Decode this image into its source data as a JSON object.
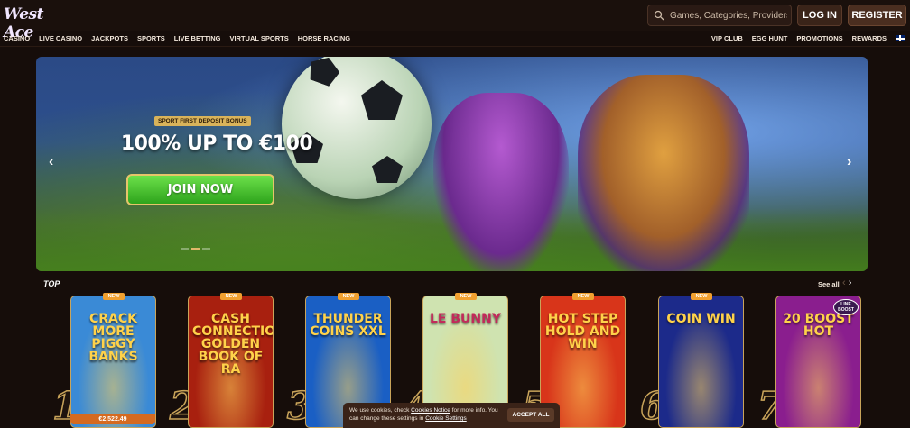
{
  "header": {
    "logo": "West Ace",
    "search_placeholder": "Games, Categories, Providers",
    "login_label": "LOG IN",
    "register_label": "REGISTER"
  },
  "nav": {
    "left": [
      "CASINO",
      "LIVE CASINO",
      "JACKPOTS",
      "SPORTS",
      "LIVE BETTING",
      "VIRTUAL SPORTS",
      "HORSE RACING"
    ],
    "right": [
      "VIP CLUB",
      "EGG HUNT",
      "PROMOTIONS",
      "REWARDS"
    ],
    "language_icon": "uk-flag-icon"
  },
  "banner": {
    "badge": "SPORT FIRST DEPOSIT BONUS",
    "headline": "100% UP TO €100",
    "cta": "JOIN NOW",
    "slide_count": 3,
    "active_slide": 1
  },
  "top_section": {
    "title": "TOP",
    "see_all": "See all",
    "games": [
      {
        "rank": "1",
        "name": "CRACK MORE PIGGY BANKS",
        "badge": "NEW",
        "jackpot": "€2,522.49",
        "bg": "#3a8ad6"
      },
      {
        "rank": "2",
        "name": "CASH CONNECTION GOLDEN BOOK OF RA",
        "badge": "NEW",
        "bg": "#a8200f"
      },
      {
        "rank": "3",
        "name": "THUNDER COINS XXL",
        "badge": "NEW",
        "bg": "#1a5fc4"
      },
      {
        "rank": "4",
        "name": "LE BUNNY",
        "badge": "NEW",
        "bg": "#cfe3b0"
      },
      {
        "rank": "5",
        "name": "HOT STEP HOLD AND WIN",
        "badge": "NEW",
        "bg": "#d8351a"
      },
      {
        "rank": "6",
        "name": "COIN WIN",
        "badge": "NEW",
        "bg": "#1c2a8a"
      },
      {
        "rank": "7",
        "name": "20 BOOST HOT",
        "badge": "LINE BOOST",
        "bg": "#8a1e8e"
      }
    ]
  },
  "cookie": {
    "text_1": "We use cookies, check ",
    "link_1": "Cookies Notice",
    "text_2": " for more info. You can change these settings in ",
    "link_2": "Cookie Settings",
    "accept": "ACCEPT ALL"
  }
}
